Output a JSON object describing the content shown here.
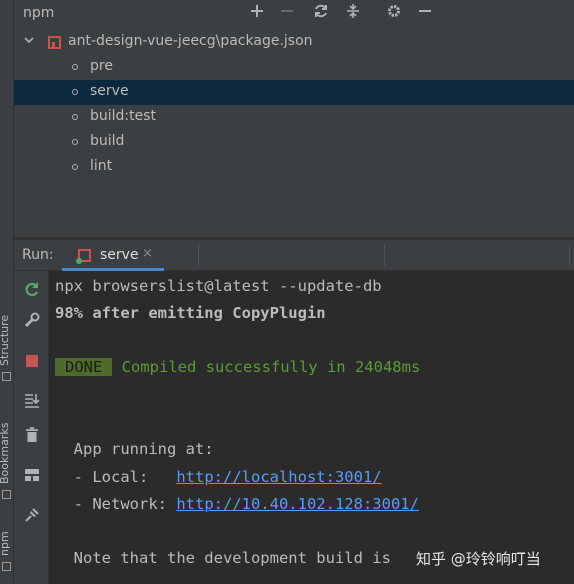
{
  "side_strip": {
    "tabs": [
      "Structure",
      "Bookmarks",
      "npm"
    ]
  },
  "npm": {
    "title": "npm",
    "toolbar_icons": [
      "plus-icon",
      "minus-icon",
      "refresh-icon",
      "collapse-icon",
      "settings-icon",
      "hide-icon"
    ],
    "root": "ant-design-vue-jeecg\\package.json",
    "scripts": [
      "pre",
      "serve",
      "build:test",
      "build",
      "lint"
    ],
    "selected_script": "serve"
  },
  "run": {
    "label": "Run:",
    "tab": {
      "label": "serve",
      "close": "×"
    },
    "toolbar_icons": [
      "rerun-icon",
      "wrench-icon",
      "stop-icon",
      "scroll-to-end-icon",
      "trash-icon",
      "layout-icon",
      "pin-icon"
    ]
  },
  "console": {
    "line1": "npx browserslist@latest --update-db",
    "line2": "98% after emitting CopyPlugin",
    "done_badge": "DONE",
    "done_text": " Compiled successfully in 24048ms",
    "app_running": "  App running at:",
    "local_label": "  - Local:   ",
    "local_url": "http://localhost:3001/",
    "network_label": "  - Network: ",
    "network_url": "http://10.40.102.128:3001/",
    "note": "  Note that the development build is"
  },
  "watermark": "知乎 @玲铃响叮当",
  "colors": {
    "panel_bg": "#3c3f41",
    "console_bg": "#2b2b2b",
    "selection": "#0d293e",
    "accent": "#4a88c7",
    "link": "#589df6",
    "success": "#5c9c35",
    "done_badge_bg": "#4e6b29",
    "npm_red": "#c75450"
  }
}
